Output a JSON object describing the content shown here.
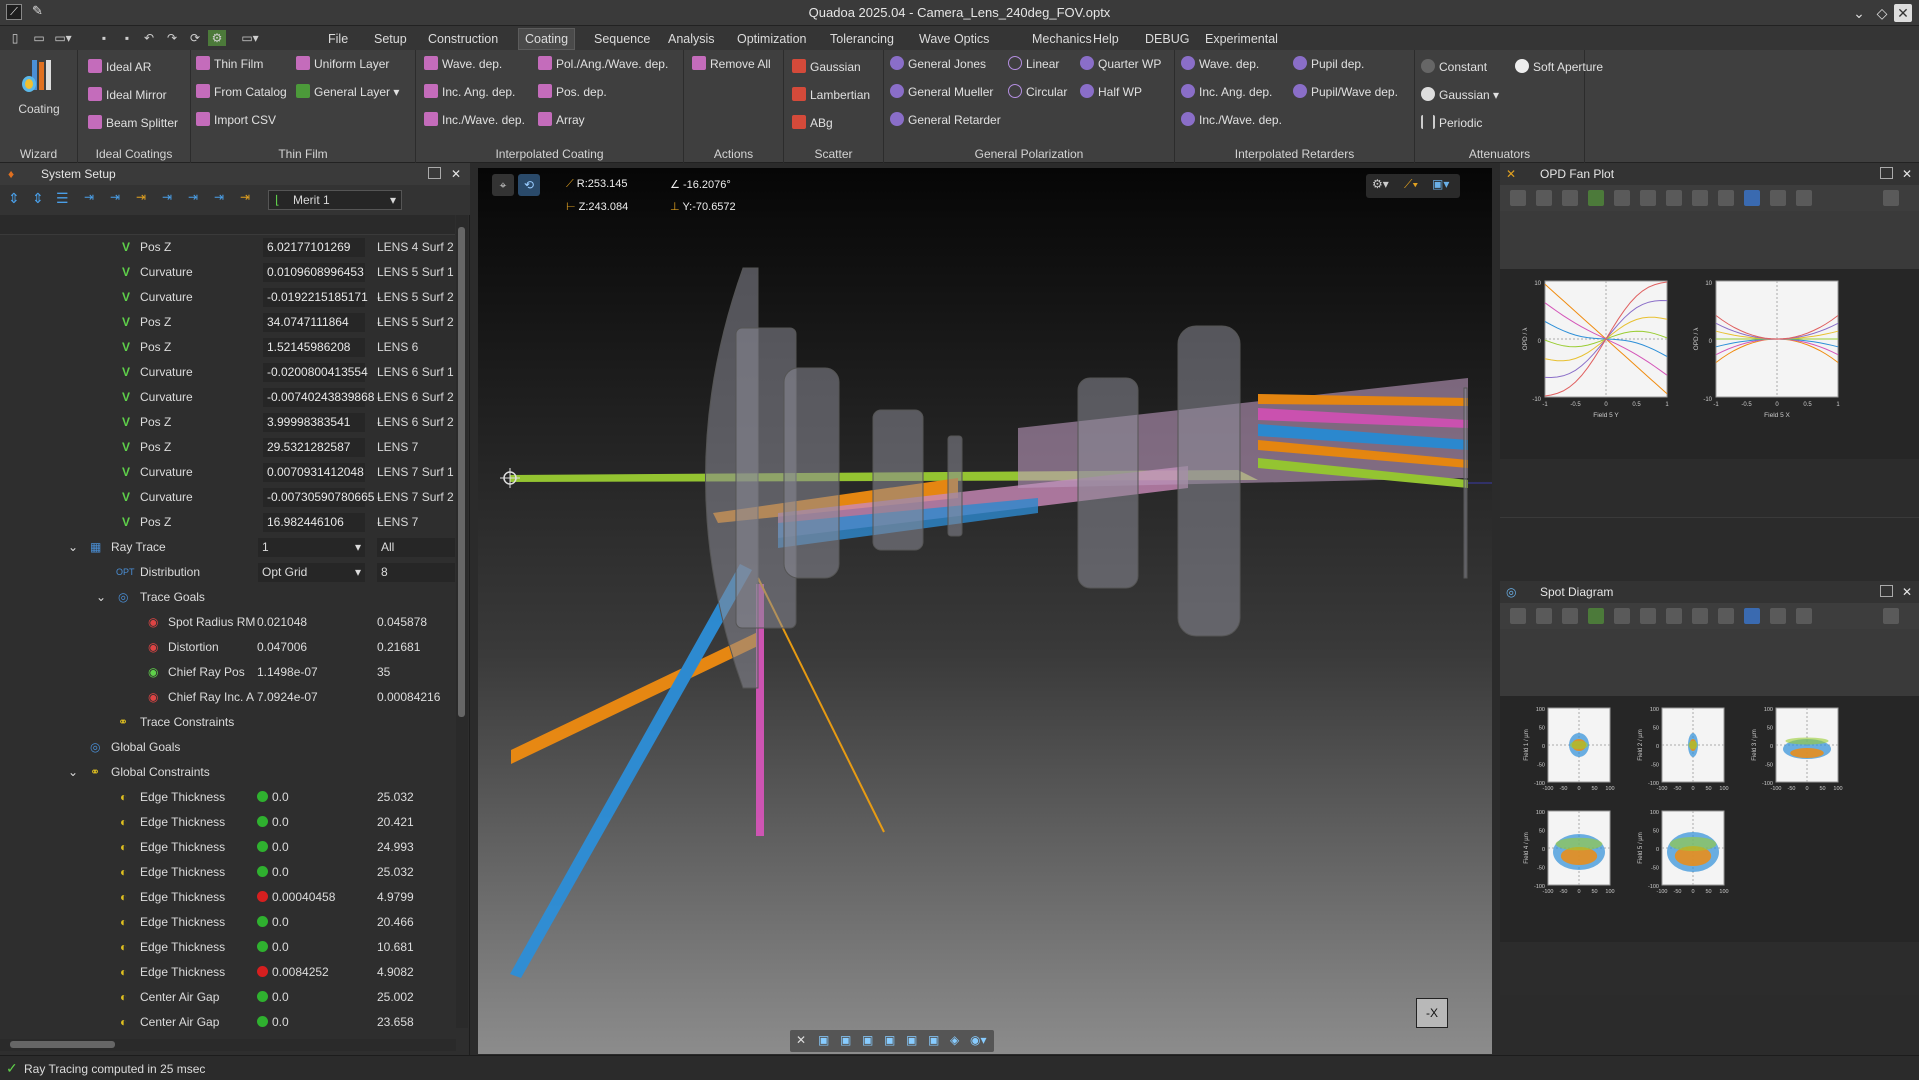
{
  "window": {
    "title": "Quadoa 2025.04 - Camera_Lens_240deg_FOV.optx"
  },
  "menu": [
    "File",
    "Setup",
    "Construction",
    "Coating",
    "Sequence",
    "Analysis",
    "Optimization",
    "Tolerancing",
    "Wave Optics",
    "Mechanics",
    "Help",
    "DEBUG",
    "Experimental"
  ],
  "ribbon": {
    "wizard": {
      "button": "Coating",
      "label": "Wizard"
    },
    "ideal": {
      "items": [
        "Ideal AR",
        "Ideal Mirror",
        "Beam Splitter"
      ],
      "label": "Ideal Coatings"
    },
    "thinfilm": {
      "items": [
        "Thin Film",
        "From Catalog",
        "Import CSV",
        "Uniform Layer",
        "General Layer"
      ],
      "label": "Thin Film"
    },
    "interp": {
      "items": [
        "Wave. dep.",
        "Inc. Ang. dep.",
        "Inc./Wave. dep.",
        "Pol./Ang./Wave. dep.",
        "Pos. dep.",
        "Array"
      ],
      "label": "Interpolated Coating"
    },
    "actions": {
      "items": [
        "Remove All"
      ],
      "label": "Actions"
    },
    "scatter": {
      "items": [
        "Gaussian",
        "Lambertian",
        "ABg"
      ],
      "label": "Scatter"
    },
    "genpol": {
      "items": [
        "General Jones",
        "General Mueller",
        "General Retarder",
        "Linear",
        "Circular",
        "Quarter WP",
        "Half WP"
      ],
      "label": "General Polarization"
    },
    "retarders": {
      "items": [
        "Wave. dep.",
        "Inc. Ang. dep.",
        "Inc./Wave. dep.",
        "Pupil dep.",
        "Pupil/Wave dep."
      ],
      "label": "Interpolated Retarders"
    },
    "atten": {
      "items": [
        "Constant",
        "Gaussian",
        "Periodic",
        "Soft Aperture"
      ],
      "label": "Attenuators"
    }
  },
  "system_setup": {
    "title": "System Setup",
    "merit": "Merit 1",
    "rows": [
      {
        "label": "Pos Z",
        "value": "6.02177101269",
        "target": "LENS 4 Surf 2"
      },
      {
        "label": "Curvature",
        "value": "0.0109608996453",
        "target": "LENS 5 Surf 1 -"
      },
      {
        "label": "Curvature",
        "value": "-0.0192215185171",
        "target": "LENS 5 Surf 2 -"
      },
      {
        "label": "Pos Z",
        "value": "34.0747111864",
        "target": "LENS 5 Surf 2"
      },
      {
        "label": "Pos Z",
        "value": "1.52145986208",
        "target": "LENS 6"
      },
      {
        "label": "Curvature",
        "value": "-0.0200800413554",
        "target": "LENS 6 Surf 1 -"
      },
      {
        "label": "Curvature",
        "value": "-0.00740243839868",
        "target": "LENS 6 Surf 2 -"
      },
      {
        "label": "Pos Z",
        "value": "3.99998383541",
        "target": "LENS 6 Surf 2"
      },
      {
        "label": "Pos Z",
        "value": "29.5321282587",
        "target": "LENS 7"
      },
      {
        "label": "Curvature",
        "value": "0.0070931412048",
        "target": "LENS 7 Surf 1 -"
      },
      {
        "label": "Curvature",
        "value": "-0.00730590780665",
        "target": "LENS 7 Surf 2 -"
      },
      {
        "label": "Pos Z",
        "value": "16.982446106",
        "target": "LENS 7"
      }
    ],
    "ray_trace": {
      "label": "Ray Trace",
      "value": "1",
      "value2": "All"
    },
    "distribution": {
      "label": "Distribution",
      "value": "Opt Grid",
      "value2": "8"
    },
    "trace_goals": {
      "label": "Trace Goals",
      "items": [
        {
          "label": "Spot Radius RM",
          "v1": "0.021048",
          "v2": "0.045878"
        },
        {
          "label": "Distortion",
          "v1": "0.047006",
          "v2": "0.21681"
        },
        {
          "label": "Chief Ray Pos",
          "v1": "1.1498e-07",
          "v2": "35"
        },
        {
          "label": "Chief Ray Inc. A",
          "v1": "7.0924e-07",
          "v2": "0.00084216"
        }
      ]
    },
    "trace_constraints": "Trace Constraints",
    "global_goals": "Global Goals",
    "global_constraints": {
      "label": "Global Constraints",
      "items": [
        {
          "label": "Edge Thickness",
          "status": "ok",
          "v1": "0.0",
          "v2": "25.032"
        },
        {
          "label": "Edge Thickness",
          "status": "ok",
          "v1": "0.0",
          "v2": "20.421"
        },
        {
          "label": "Edge Thickness",
          "status": "ok",
          "v1": "0.0",
          "v2": "24.993"
        },
        {
          "label": "Edge Thickness",
          "status": "ok",
          "v1": "0.0",
          "v2": "25.032"
        },
        {
          "label": "Edge Thickness",
          "status": "bad",
          "v1": "0.00040458",
          "v2": "4.9799"
        },
        {
          "label": "Edge Thickness",
          "status": "ok",
          "v1": "0.0",
          "v2": "20.466"
        },
        {
          "label": "Edge Thickness",
          "status": "ok",
          "v1": "0.0",
          "v2": "10.681"
        },
        {
          "label": "Edge Thickness",
          "status": "bad",
          "v1": "0.0084252",
          "v2": "4.9082"
        },
        {
          "label": "Center Air Gap",
          "status": "ok",
          "v1": "0.0",
          "v2": "25.002"
        },
        {
          "label": "Center Air Gap",
          "status": "ok",
          "v1": "0.0",
          "v2": "23.658"
        }
      ]
    }
  },
  "viewport": {
    "readouts": {
      "r": "R:253.145",
      "z": "Z:243.084",
      "angle": "-16.2076°",
      "y": "Y:-70.6572"
    },
    "axis_button": "-X"
  },
  "opd_panel": {
    "title": "OPD Fan Plot",
    "plots": [
      {
        "ylabel": "OPD / λ",
        "xlabel": "Field 5 Y",
        "yticks": [
          "10",
          "0",
          "-10"
        ],
        "xticks": [
          "-1",
          "-0.5",
          "0",
          "0.5",
          "1"
        ]
      },
      {
        "ylabel": "OPD / λ",
        "xlabel": "Field 5 X",
        "yticks": [
          "10",
          "0",
          "-10"
        ],
        "xticks": [
          "-1",
          "-0.5",
          "0",
          "0.5",
          "1"
        ]
      }
    ]
  },
  "spot_panel": {
    "title": "Spot Diagram",
    "plots": [
      {
        "ylabel": "Field 1 / µm"
      },
      {
        "ylabel": "Field 2 / µm"
      },
      {
        "ylabel": "Field 3 / µm"
      },
      {
        "ylabel": "Field 4 / µm"
      },
      {
        "ylabel": "Field 5 / µm"
      }
    ],
    "yticks": [
      "100",
      "50",
      "0",
      "-50",
      "-100"
    ],
    "xticks": [
      "-100",
      "-50",
      "0",
      "50",
      "100"
    ]
  },
  "status": {
    "text": "Ray Tracing computed in 25 msec"
  },
  "colors": {
    "accent": "#4a8fd6",
    "ok": "#2fb12f",
    "bad": "#d61f1f",
    "orange": "#f08c10",
    "blue": "#2d8fd8",
    "pink": "#d455b8",
    "green": "#9acd32"
  }
}
